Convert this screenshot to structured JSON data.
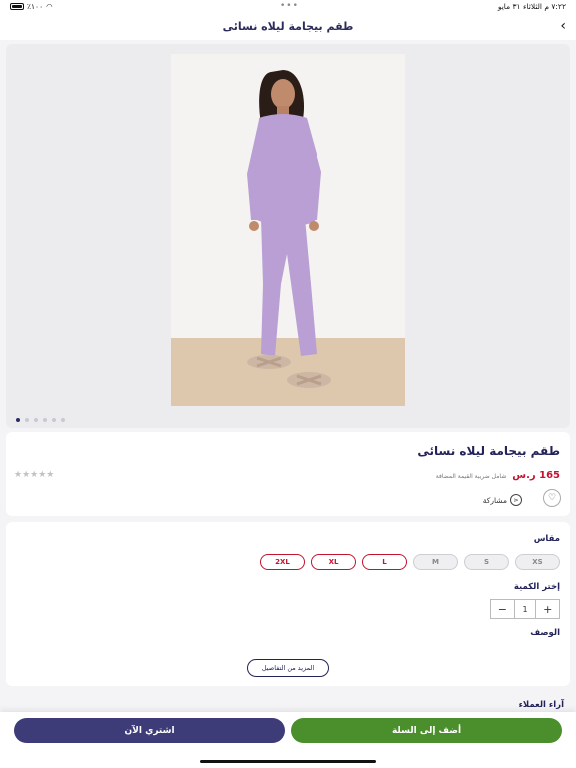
{
  "status_bar": {
    "time": "٧:٢٢ م  الثلاثاء ٣١ مايو",
    "battery": "٪١٠٠",
    "multitask_dots": "•••"
  },
  "nav": {
    "title": "طقم بيجامة ليلاه نسائى",
    "back_icon": "chevron-left-icon"
  },
  "gallery": {
    "page_count": 6,
    "active_index": 0
  },
  "product": {
    "title": "طقم بيجامة ليلاه نسائى",
    "price": "165 ر.س",
    "vat_note": "شامل ضريبة القيمة المضافة",
    "rating_stars": "★★★★★",
    "share_label": "مشاركة"
  },
  "options": {
    "size_label": "مقاس",
    "sizes": [
      {
        "label": "XS",
        "available": false
      },
      {
        "label": "S",
        "available": false
      },
      {
        "label": "M",
        "available": false
      },
      {
        "label": "L",
        "available": true
      },
      {
        "label": "XL",
        "available": true
      },
      {
        "label": "2XL",
        "available": true
      }
    ],
    "quantity_label": "إختر الكمية",
    "quantity_value": "1",
    "plus": "+",
    "minus": "−",
    "description_label": "الوصف",
    "more_details": "المزيد من التفاصيل"
  },
  "reviews": {
    "label": "آراء العملاء"
  },
  "actions": {
    "add_to_cart": "أضف إلى السلة",
    "buy_now": "اشتري الآن"
  },
  "colors": {
    "primary": "#23235a",
    "price": "#c4122f",
    "cart": "#4a8f2c",
    "buy": "#3d3b78",
    "product_lilac": "#b99fd4"
  }
}
